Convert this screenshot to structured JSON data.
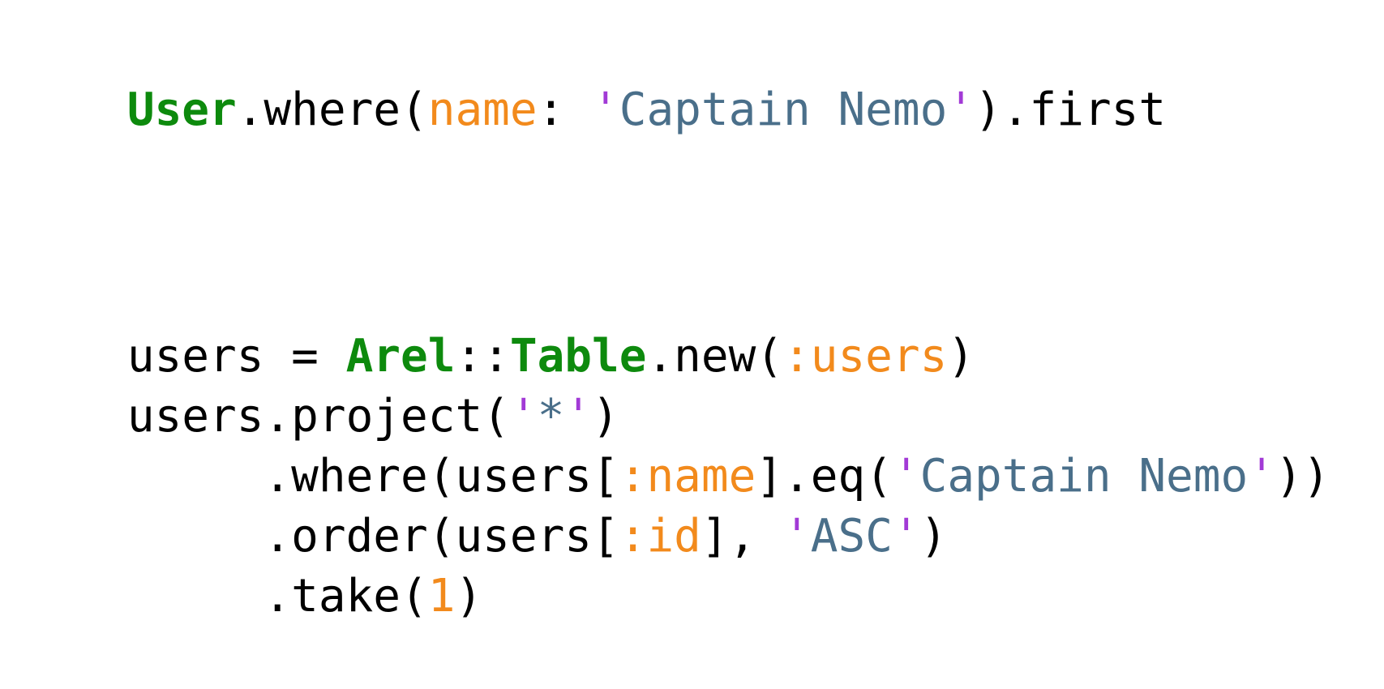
{
  "colors": {
    "plain": "#000000",
    "constant": "#0d8a0d",
    "symbol": "#f28a1c",
    "string": "#4a6f8a",
    "quote": "#a23ad6",
    "background": "#ffffff"
  },
  "code": {
    "lines": [
      {
        "tokens": [
          {
            "text": "User",
            "kind": "constant"
          },
          {
            "text": ".where(",
            "kind": "plain"
          },
          {
            "text": "name",
            "kind": "symbol"
          },
          {
            "text": ": ",
            "kind": "plain"
          },
          {
            "text": "'",
            "kind": "quote"
          },
          {
            "text": "Captain Nemo",
            "kind": "string"
          },
          {
            "text": "'",
            "kind": "quote"
          },
          {
            "text": ").first",
            "kind": "plain"
          }
        ]
      },
      {
        "tokens": [
          {
            "text": "users = ",
            "kind": "plain"
          },
          {
            "text": "Arel",
            "kind": "constant"
          },
          {
            "text": "::",
            "kind": "plain"
          },
          {
            "text": "Table",
            "kind": "constant"
          },
          {
            "text": ".new(",
            "kind": "plain"
          },
          {
            "text": ":users",
            "kind": "symbol"
          },
          {
            "text": ")",
            "kind": "plain"
          }
        ]
      },
      {
        "tokens": [
          {
            "text": "users.project(",
            "kind": "plain"
          },
          {
            "text": "'",
            "kind": "quote"
          },
          {
            "text": "*",
            "kind": "string"
          },
          {
            "text": "'",
            "kind": "quote"
          },
          {
            "text": ")",
            "kind": "plain"
          }
        ]
      },
      {
        "tokens": [
          {
            "text": "     .where(users[",
            "kind": "plain"
          },
          {
            "text": ":name",
            "kind": "symbol"
          },
          {
            "text": "].eq(",
            "kind": "plain"
          },
          {
            "text": "'",
            "kind": "quote"
          },
          {
            "text": "Captain Nemo",
            "kind": "string"
          },
          {
            "text": "'",
            "kind": "quote"
          },
          {
            "text": "))",
            "kind": "plain"
          }
        ]
      },
      {
        "tokens": [
          {
            "text": "     .order(users[",
            "kind": "plain"
          },
          {
            "text": ":id",
            "kind": "symbol"
          },
          {
            "text": "], ",
            "kind": "plain"
          },
          {
            "text": "'",
            "kind": "quote"
          },
          {
            "text": "ASC",
            "kind": "string"
          },
          {
            "text": "'",
            "kind": "quote"
          },
          {
            "text": ")",
            "kind": "plain"
          }
        ]
      },
      {
        "tokens": [
          {
            "text": "     .take(",
            "kind": "plain"
          },
          {
            "text": "1",
            "kind": "symbol"
          },
          {
            "text": ")",
            "kind": "plain"
          }
        ]
      }
    ]
  }
}
